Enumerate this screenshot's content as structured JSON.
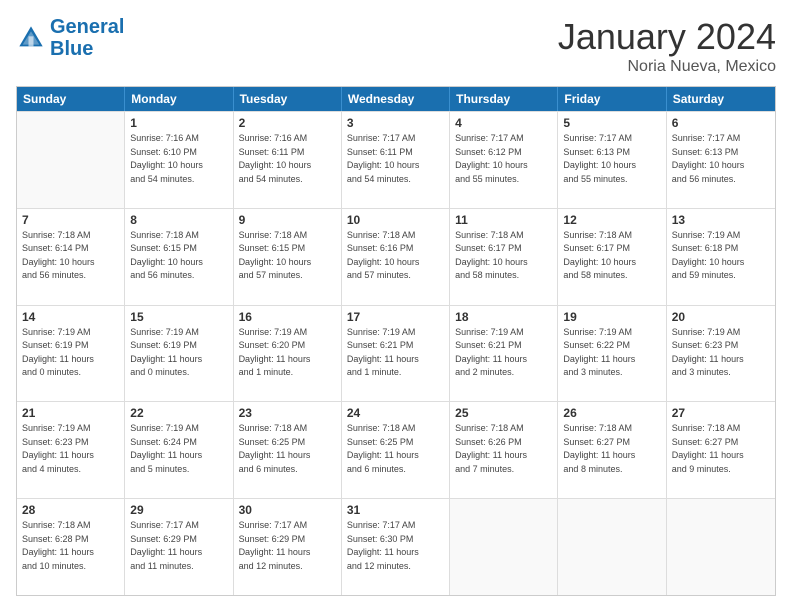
{
  "logo": {
    "text1": "General",
    "text2": "Blue"
  },
  "title": "January 2024",
  "location": "Noria Nueva, Mexico",
  "header_days": [
    "Sunday",
    "Monday",
    "Tuesday",
    "Wednesday",
    "Thursday",
    "Friday",
    "Saturday"
  ],
  "weeks": [
    [
      {
        "day": "",
        "info": ""
      },
      {
        "day": "1",
        "info": "Sunrise: 7:16 AM\nSunset: 6:10 PM\nDaylight: 10 hours\nand 54 minutes."
      },
      {
        "day": "2",
        "info": "Sunrise: 7:16 AM\nSunset: 6:11 PM\nDaylight: 10 hours\nand 54 minutes."
      },
      {
        "day": "3",
        "info": "Sunrise: 7:17 AM\nSunset: 6:11 PM\nDaylight: 10 hours\nand 54 minutes."
      },
      {
        "day": "4",
        "info": "Sunrise: 7:17 AM\nSunset: 6:12 PM\nDaylight: 10 hours\nand 55 minutes."
      },
      {
        "day": "5",
        "info": "Sunrise: 7:17 AM\nSunset: 6:13 PM\nDaylight: 10 hours\nand 55 minutes."
      },
      {
        "day": "6",
        "info": "Sunrise: 7:17 AM\nSunset: 6:13 PM\nDaylight: 10 hours\nand 56 minutes."
      }
    ],
    [
      {
        "day": "7",
        "info": "Sunrise: 7:18 AM\nSunset: 6:14 PM\nDaylight: 10 hours\nand 56 minutes."
      },
      {
        "day": "8",
        "info": "Sunrise: 7:18 AM\nSunset: 6:15 PM\nDaylight: 10 hours\nand 56 minutes."
      },
      {
        "day": "9",
        "info": "Sunrise: 7:18 AM\nSunset: 6:15 PM\nDaylight: 10 hours\nand 57 minutes."
      },
      {
        "day": "10",
        "info": "Sunrise: 7:18 AM\nSunset: 6:16 PM\nDaylight: 10 hours\nand 57 minutes."
      },
      {
        "day": "11",
        "info": "Sunrise: 7:18 AM\nSunset: 6:17 PM\nDaylight: 10 hours\nand 58 minutes."
      },
      {
        "day": "12",
        "info": "Sunrise: 7:18 AM\nSunset: 6:17 PM\nDaylight: 10 hours\nand 58 minutes."
      },
      {
        "day": "13",
        "info": "Sunrise: 7:19 AM\nSunset: 6:18 PM\nDaylight: 10 hours\nand 59 minutes."
      }
    ],
    [
      {
        "day": "14",
        "info": "Sunrise: 7:19 AM\nSunset: 6:19 PM\nDaylight: 11 hours\nand 0 minutes."
      },
      {
        "day": "15",
        "info": "Sunrise: 7:19 AM\nSunset: 6:19 PM\nDaylight: 11 hours\nand 0 minutes."
      },
      {
        "day": "16",
        "info": "Sunrise: 7:19 AM\nSunset: 6:20 PM\nDaylight: 11 hours\nand 1 minute."
      },
      {
        "day": "17",
        "info": "Sunrise: 7:19 AM\nSunset: 6:21 PM\nDaylight: 11 hours\nand 1 minute."
      },
      {
        "day": "18",
        "info": "Sunrise: 7:19 AM\nSunset: 6:21 PM\nDaylight: 11 hours\nand 2 minutes."
      },
      {
        "day": "19",
        "info": "Sunrise: 7:19 AM\nSunset: 6:22 PM\nDaylight: 11 hours\nand 3 minutes."
      },
      {
        "day": "20",
        "info": "Sunrise: 7:19 AM\nSunset: 6:23 PM\nDaylight: 11 hours\nand 3 minutes."
      }
    ],
    [
      {
        "day": "21",
        "info": "Sunrise: 7:19 AM\nSunset: 6:23 PM\nDaylight: 11 hours\nand 4 minutes."
      },
      {
        "day": "22",
        "info": "Sunrise: 7:19 AM\nSunset: 6:24 PM\nDaylight: 11 hours\nand 5 minutes."
      },
      {
        "day": "23",
        "info": "Sunrise: 7:18 AM\nSunset: 6:25 PM\nDaylight: 11 hours\nand 6 minutes."
      },
      {
        "day": "24",
        "info": "Sunrise: 7:18 AM\nSunset: 6:25 PM\nDaylight: 11 hours\nand 6 minutes."
      },
      {
        "day": "25",
        "info": "Sunrise: 7:18 AM\nSunset: 6:26 PM\nDaylight: 11 hours\nand 7 minutes."
      },
      {
        "day": "26",
        "info": "Sunrise: 7:18 AM\nSunset: 6:27 PM\nDaylight: 11 hours\nand 8 minutes."
      },
      {
        "day": "27",
        "info": "Sunrise: 7:18 AM\nSunset: 6:27 PM\nDaylight: 11 hours\nand 9 minutes."
      }
    ],
    [
      {
        "day": "28",
        "info": "Sunrise: 7:18 AM\nSunset: 6:28 PM\nDaylight: 11 hours\nand 10 minutes."
      },
      {
        "day": "29",
        "info": "Sunrise: 7:17 AM\nSunset: 6:29 PM\nDaylight: 11 hours\nand 11 minutes."
      },
      {
        "day": "30",
        "info": "Sunrise: 7:17 AM\nSunset: 6:29 PM\nDaylight: 11 hours\nand 12 minutes."
      },
      {
        "day": "31",
        "info": "Sunrise: 7:17 AM\nSunset: 6:30 PM\nDaylight: 11 hours\nand 12 minutes."
      },
      {
        "day": "",
        "info": ""
      },
      {
        "day": "",
        "info": ""
      },
      {
        "day": "",
        "info": ""
      }
    ]
  ]
}
